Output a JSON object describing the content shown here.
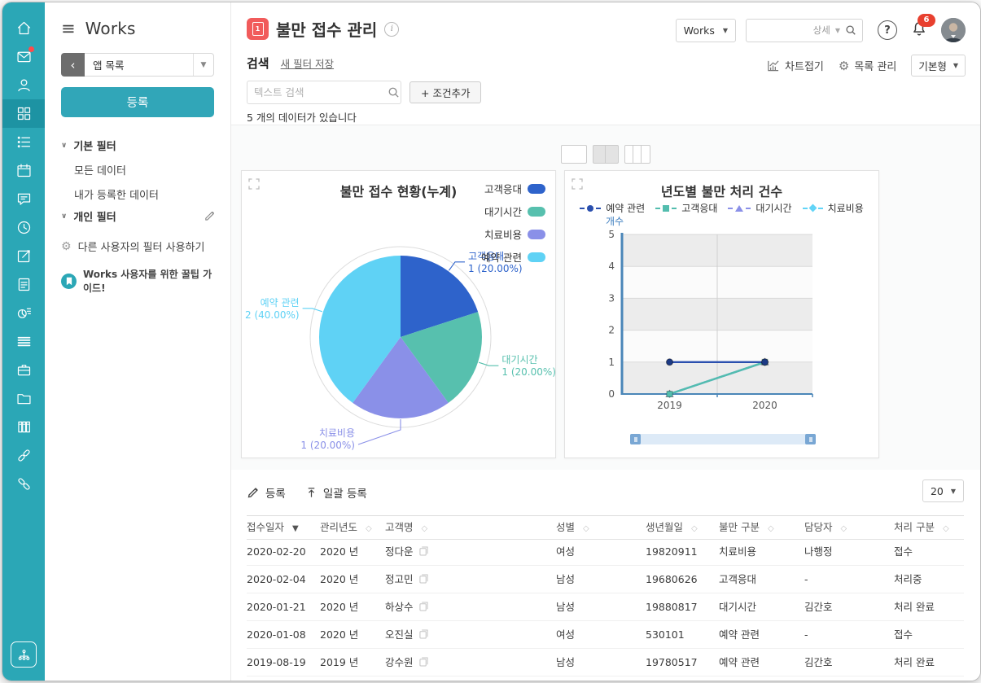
{
  "nav": {
    "items": [
      {
        "icon": "home"
      },
      {
        "icon": "mail",
        "badge": true
      },
      {
        "icon": "user"
      },
      {
        "icon": "apps",
        "selected": true
      },
      {
        "icon": "list"
      },
      {
        "icon": "calendar"
      },
      {
        "icon": "chat"
      },
      {
        "icon": "clock"
      },
      {
        "icon": "compose"
      },
      {
        "icon": "document"
      },
      {
        "icon": "report"
      },
      {
        "icon": "rows"
      },
      {
        "icon": "briefcase"
      },
      {
        "icon": "folder"
      },
      {
        "icon": "cabinet"
      },
      {
        "icon": "link"
      },
      {
        "icon": "link-alt"
      }
    ],
    "bottom_icon": "org-chart"
  },
  "sidebar": {
    "title": "Works",
    "app_list": "앱 목록",
    "register": "등록",
    "basic_filter": {
      "label": "기본 필터",
      "items": [
        "모든 데이터",
        "내가 등록한 데이터"
      ]
    },
    "personal_filter": {
      "label": "개인 필터"
    },
    "use_others_filter": "다른 사용자의 필터 사용하기",
    "guide": "Works 사용자를 위한 꿀팁 가이드!"
  },
  "header": {
    "app_icon_text": "1",
    "title": "불만 접수 관리",
    "scope": "Works",
    "search_detail": "상세",
    "notifications": "6"
  },
  "filterbar": {
    "search": "검색",
    "save_new_filter": "새 필터 저장",
    "chart_fold": "차트접기",
    "list_manage": "목록 관리",
    "view_type": "기본형",
    "text_search_placeholder": "텍스트 검색",
    "add_condition": "+ 조건추가",
    "count_text": "5 개의 데이터가 있습니다"
  },
  "chart_data": [
    {
      "type": "pie",
      "title": "불만 접수 현황(누계)",
      "labels": [
        "고객응대",
        "대기시간",
        "치료비용",
        "예약 관련"
      ],
      "values": [
        1,
        1,
        1,
        2
      ],
      "percent_labels": [
        "1 (20.00%)",
        "1 (20.00%)",
        "1 (20.00%)",
        "2 (40.00%)"
      ],
      "colors": [
        "#2e63cb",
        "#57c0ae",
        "#8a90e8",
        "#5fd2f5"
      ],
      "legend_position": "right"
    },
    {
      "type": "line",
      "title": "년도별 불만 처리 건수",
      "ylabel": "개수",
      "x": [
        "2019",
        "2020"
      ],
      "ylim": [
        0,
        5
      ],
      "yticks": [
        0,
        1,
        2,
        3,
        4,
        5
      ],
      "grid": true,
      "legend_position": "top",
      "series": [
        {
          "name": "예약 관련",
          "marker": "circle",
          "color": "#2a4fae",
          "values": [
            1,
            1
          ]
        },
        {
          "name": "고객응대",
          "marker": "square",
          "color": "#53bdae",
          "values": [
            0,
            1
          ]
        },
        {
          "name": "대기시간",
          "marker": "triangle",
          "color": "#8a90e8",
          "values": [
            0,
            1
          ]
        },
        {
          "name": "치료비용",
          "marker": "diamond",
          "color": "#62d4f7",
          "values": [
            0,
            1
          ]
        }
      ]
    }
  ],
  "table": {
    "register": "등록",
    "bulk_register": "일괄 등록",
    "page_size": "20",
    "columns": [
      {
        "label": "접수일자",
        "sort": "desc"
      },
      {
        "label": "관리년도",
        "sort": "none"
      },
      {
        "label": "고객명",
        "sort": "none"
      },
      {
        "label": "성별",
        "sort": "none"
      },
      {
        "label": "생년월일",
        "sort": "none"
      },
      {
        "label": "불만 구분",
        "sort": "none"
      },
      {
        "label": "담당자",
        "sort": "none"
      },
      {
        "label": "처리 구분",
        "sort": "none"
      }
    ],
    "rows": [
      [
        "2020-02-20",
        "2020 년",
        "정다운",
        "여성",
        "19820911",
        "치료비용",
        "나행정",
        "접수"
      ],
      [
        "2020-02-04",
        "2020 년",
        "정고민",
        "남성",
        "19680626",
        "고객응대",
        "-",
        "처리중"
      ],
      [
        "2020-01-21",
        "2020 년",
        "하상수",
        "남성",
        "19880817",
        "대기시간",
        "김간호",
        "처리 완료"
      ],
      [
        "2020-01-08",
        "2020 년",
        "오진실",
        "여성",
        "530101",
        "예약 관련",
        "-",
        "접수"
      ],
      [
        "2019-08-19",
        "2019 년",
        "강수원",
        "남성",
        "19780517",
        "예약 관련",
        "김간호",
        "처리 완료"
      ]
    ]
  }
}
